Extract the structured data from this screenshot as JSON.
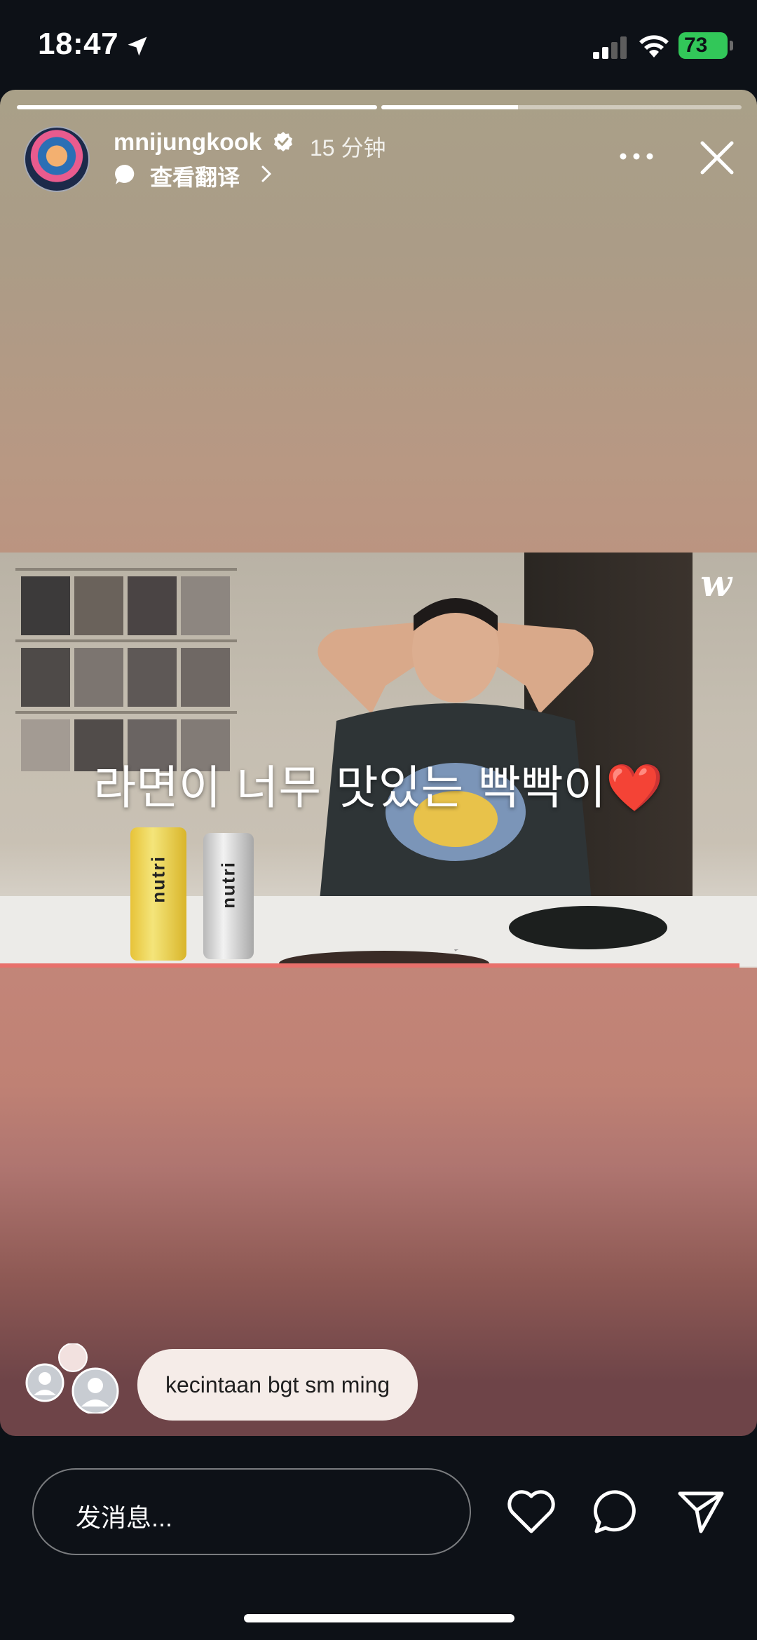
{
  "status_bar": {
    "time": "18:47",
    "battery": "73"
  },
  "story": {
    "progress": [
      1.0,
      0.38
    ],
    "username": "mnijungkook",
    "time_ago": "15 分钟",
    "translate_label": "查看翻译",
    "video": {
      "logo": "w",
      "caption": "라면이 너무 맛있는 빡빡이",
      "caption_emoji": "❤️",
      "can_label_1": "nutri",
      "can_label_2": "nutri"
    },
    "comment": "kecintaan bgt sm ming"
  },
  "bottom_bar": {
    "message_placeholder": "发消息..."
  },
  "icons": [
    "location-arrow-icon",
    "signal-icon",
    "wifi-icon",
    "verified-badge-icon",
    "translate-bubble-icon",
    "chevron-right-icon",
    "more-icon",
    "close-icon",
    "heart-icon",
    "comment-icon",
    "send-icon"
  ]
}
